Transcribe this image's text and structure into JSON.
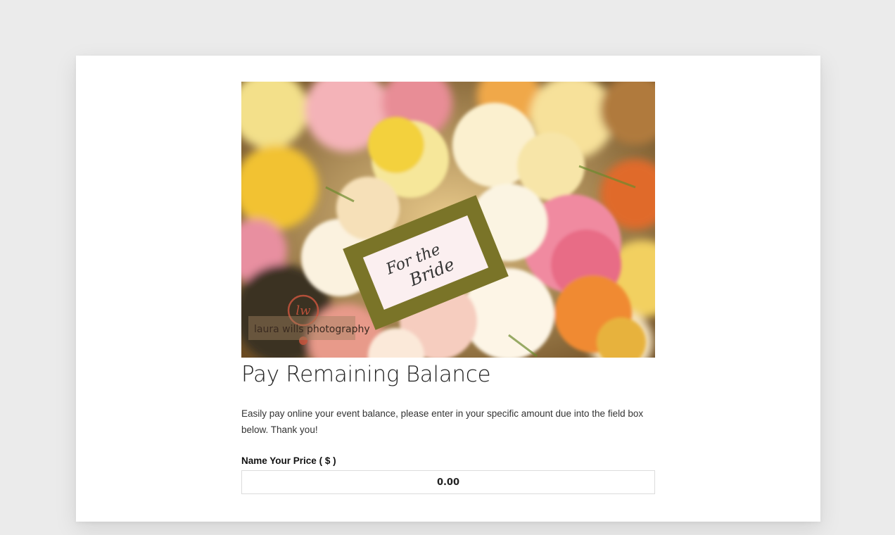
{
  "hero": {
    "image_alt": "Bouquet of yellow, pink and orange flowers with a card reading For the Bride",
    "card_text_line1": "For the",
    "card_text_line2": "Bride",
    "watermark_text": "laura wills photography",
    "watermark_logo": "lw"
  },
  "page": {
    "title": "Pay Remaining Balance",
    "description": "Easily pay online your event balance, please enter in your specific amount due into the field box below. Thank you!"
  },
  "price_field": {
    "label": "Name Your Price",
    "unit": "( $ )",
    "value": "0.00"
  },
  "colors": {
    "background": "#ebebeb",
    "card": "#ffffff",
    "text": "#222222",
    "card_frame": "#7a7428"
  }
}
